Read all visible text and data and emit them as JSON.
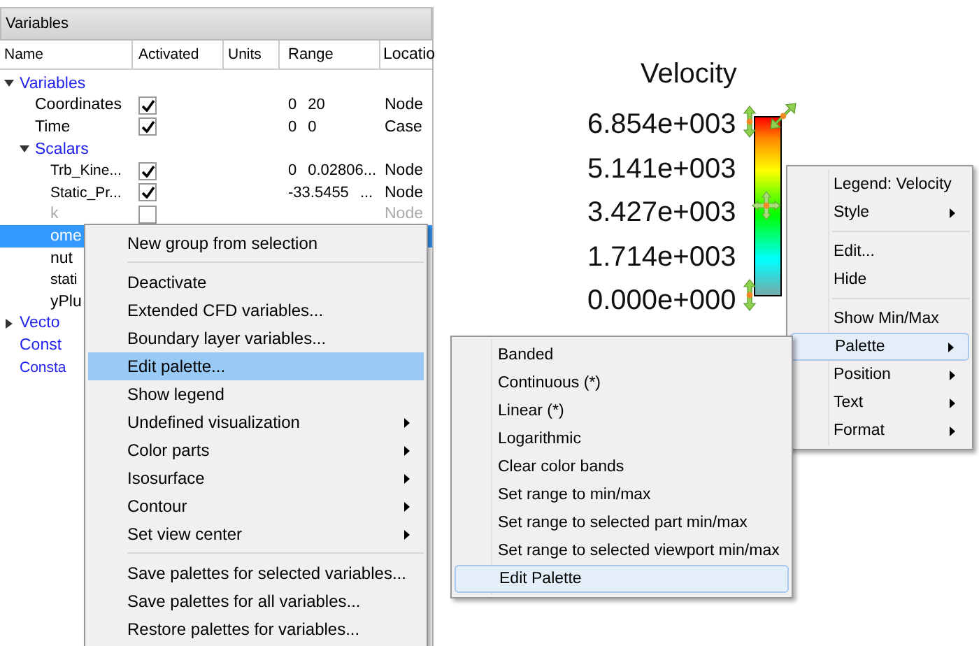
{
  "panel": {
    "title": "Variables",
    "columns": [
      "Name",
      "Activated",
      "Units",
      "Range",
      "Locatio"
    ],
    "tree": [
      {
        "label": "Variables",
        "kind": "group",
        "expanded": true,
        "children": [
          {
            "label": "Coordinates",
            "kind": "variable",
            "checked": true,
            "range_min": "0",
            "range_max": "20",
            "location": "Node",
            "disabled": false,
            "selected": false
          },
          {
            "label": "Time",
            "kind": "variable",
            "checked": true,
            "range_min": "0",
            "range_max": "0",
            "location": "Case",
            "disabled": false,
            "selected": false
          },
          {
            "label": "Scalars",
            "kind": "group",
            "expanded": true,
            "children": [
              {
                "label": "Trb_Kine...",
                "kind": "variable",
                "checked": true,
                "range_min": "0",
                "range_max": "0.02806...",
                "location": "Node",
                "disabled": false,
                "selected": false,
                "small": true
              },
              {
                "label": "Static_Pr...",
                "kind": "variable",
                "checked": true,
                "range_min": "-33.5455",
                "range_max": "...",
                "location": "Node",
                "disabled": false,
                "selected": false,
                "small": true
              },
              {
                "label": "k",
                "kind": "variable",
                "checked": false,
                "location": "Node",
                "disabled": true,
                "selected": false
              },
              {
                "label": "ome",
                "kind": "variable",
                "disabled": false,
                "selected": true
              },
              {
                "label": "nut",
                "kind": "variable",
                "disabled": false,
                "selected": false
              },
              {
                "label": "stati",
                "kind": "variable",
                "disabled": false,
                "selected": false,
                "small": true
              },
              {
                "label": "yPlu",
                "kind": "variable",
                "disabled": false,
                "selected": false
              }
            ]
          }
        ]
      },
      {
        "label": "Vecto",
        "kind": "group",
        "expanded": false
      },
      {
        "label": "Const",
        "kind": "group"
      },
      {
        "label": "Consta",
        "kind": "group",
        "small": true
      }
    ]
  },
  "context_menu": {
    "items": [
      {
        "label": "New group from selection",
        "submenu": false,
        "selected": false,
        "separator_after": true
      },
      {
        "label": "Deactivate",
        "submenu": false,
        "selected": false
      },
      {
        "label": "Extended CFD variables...",
        "submenu": false,
        "selected": false
      },
      {
        "label": "Boundary layer variables...",
        "submenu": false,
        "selected": false
      },
      {
        "label": "Edit palette...",
        "submenu": false,
        "selected": true
      },
      {
        "label": "Show legend",
        "submenu": false,
        "selected": false
      },
      {
        "label": "Undefined visualization",
        "submenu": true,
        "selected": false
      },
      {
        "label": "Color parts",
        "submenu": true,
        "selected": false
      },
      {
        "label": "Isosurface",
        "submenu": true,
        "selected": false
      },
      {
        "label": "Contour",
        "submenu": true,
        "selected": false
      },
      {
        "label": "Set view center",
        "submenu": true,
        "selected": false,
        "separator_after": true
      },
      {
        "label": "Save palettes for selected variables...",
        "submenu": false,
        "selected": false
      },
      {
        "label": "Save palettes for all variables...",
        "submenu": false,
        "selected": false
      },
      {
        "label": "Restore palettes for variables...",
        "submenu": false,
        "selected": false
      }
    ]
  },
  "legend": {
    "title": "Velocity",
    "labels": [
      "6.854e+003",
      "5.141e+003",
      "3.427e+003",
      "1.714e+003",
      "0.000e+000"
    ]
  },
  "legend_menu": {
    "items": [
      {
        "label": "Legend: Velocity",
        "submenu": false,
        "selected": false
      },
      {
        "label": "Style",
        "submenu": true,
        "selected": false,
        "separator_after": true
      },
      {
        "label": "Edit...",
        "submenu": false,
        "selected": false
      },
      {
        "label": "Hide",
        "submenu": false,
        "selected": false,
        "separator_after": true
      },
      {
        "label": "Show Min/Max",
        "submenu": false,
        "selected": false
      },
      {
        "label": "Palette",
        "submenu": true,
        "selected": true
      },
      {
        "label": "Position",
        "submenu": true,
        "selected": false
      },
      {
        "label": "Text",
        "submenu": true,
        "selected": false
      },
      {
        "label": "Format",
        "submenu": true,
        "selected": false
      }
    ]
  },
  "palette_submenu": {
    "items": [
      {
        "label": "Banded",
        "submenu": false,
        "selected": false
      },
      {
        "label": "Continuous (*)",
        "submenu": false,
        "selected": false
      },
      {
        "label": "Linear (*)",
        "submenu": false,
        "selected": false
      },
      {
        "label": "Logarithmic",
        "submenu": false,
        "selected": false
      },
      {
        "label": "Clear color bands",
        "submenu": false,
        "selected": false
      },
      {
        "label": "Set range to min/max",
        "submenu": false,
        "selected": false
      },
      {
        "label": "Set range to selected part min/max",
        "submenu": false,
        "selected": false
      },
      {
        "label": "Set range to selected viewport min/max",
        "submenu": false,
        "selected": false
      },
      {
        "label": "Edit Palette",
        "submenu": false,
        "selected": true
      }
    ]
  }
}
